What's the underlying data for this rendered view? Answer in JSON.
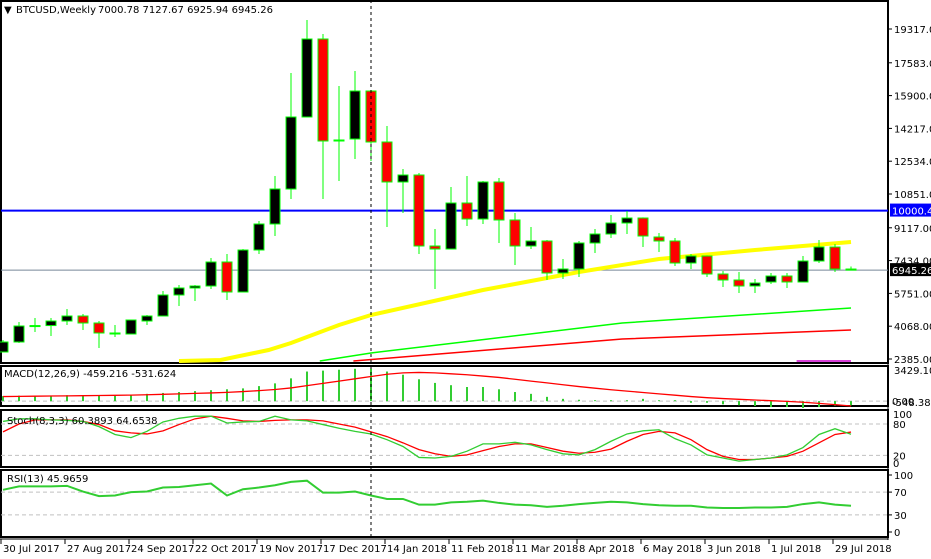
{
  "header": {
    "arrow": "▼",
    "symbol": "BTCUSD,Weekly",
    "ohlc": "7000.78 7127.67 6925.94 6945.26"
  },
  "colors": {
    "bull_body": "#000000",
    "bear_body": "#ff0000",
    "candle_outline": "#00ff00",
    "ma_fast": "#ffff00",
    "ma_mid": "#00ff00",
    "ma_slow": "#ff0000",
    "ma_extra": "#cc00cc",
    "level_line": "#0000ff",
    "price_line": "#778899",
    "indicator_main": "#32cd32",
    "indicator_signal": "#ff0000",
    "grid_dash": "#c0c0c0"
  },
  "price_axis": {
    "ticks": [
      "19317.00",
      "17583.00",
      "15900.00",
      "14217.00",
      "12534.00",
      "10851.00",
      "9117.00",
      "7434.00",
      "5751.00",
      "4068.00",
      "2385.00"
    ]
  },
  "horizontal_level": {
    "value": 10000.41,
    "label": "10000.41"
  },
  "current_price": {
    "value": 6945.26,
    "label": "6945.26"
  },
  "time_axis": {
    "labels": [
      {
        "i": 0,
        "text": "30 Jul 2017"
      },
      {
        "i": 4,
        "text": "27 Aug 2017"
      },
      {
        "i": 8,
        "text": "24 Sep 2017"
      },
      {
        "i": 12,
        "text": "22 Oct 2017"
      },
      {
        "i": 16,
        "text": "19 Nov 2017"
      },
      {
        "i": 20,
        "text": "17 Dec 2017"
      },
      {
        "i": 24,
        "text": "14 Jan 2018"
      },
      {
        "i": 28,
        "text": "11 Feb 2018"
      },
      {
        "i": 32,
        "text": "11 Mar 2018"
      },
      {
        "i": 36,
        "text": "8 Apr 2018"
      },
      {
        "i": 40,
        "text": "6 May 2018"
      },
      {
        "i": 44,
        "text": "3 Jun 2018"
      },
      {
        "i": 48,
        "text": "1 Jul 2018"
      },
      {
        "i": 52,
        "text": "29 Jul 2018"
      }
    ]
  },
  "crosshair_index": 23,
  "chart_data": {
    "type": "candlestick",
    "candles": [
      [
        2744,
        3360,
        2744,
        3257
      ],
      [
        3257,
        4283,
        3206,
        4078
      ],
      [
        4078,
        4488,
        3770,
        4100
      ],
      [
        4100,
        4488,
        3565,
        4334
      ],
      [
        4334,
        4950,
        4129,
        4591
      ],
      [
        4591,
        4694,
        3873,
        4232
      ],
      [
        4232,
        4334,
        2949,
        3719
      ],
      [
        3719,
        4129,
        3514,
        3667
      ],
      [
        3667,
        4400,
        3667,
        4386
      ],
      [
        4334,
        4642,
        4129,
        4591
      ],
      [
        4591,
        5874,
        4591,
        5669
      ],
      [
        5669,
        6182,
        5104,
        6028
      ],
      [
        6028,
        6182,
        5361,
        6130
      ],
      [
        6130,
        7567,
        5976,
        7362
      ],
      [
        7362,
        7772,
        5412,
        5822
      ],
      [
        5822,
        8029,
        5822,
        7977
      ],
      [
        7977,
        9465,
        7772,
        9312
      ],
      [
        9312,
        11774,
        8696,
        11107
      ],
      [
        11107,
        17059,
        10594,
        14802
      ],
      [
        14802,
        19779,
        14802,
        18804
      ],
      [
        18804,
        19060,
        10594,
        13570
      ],
      [
        13570,
        16392,
        11518,
        13622
      ],
      [
        13673,
        17162,
        12647,
        16136
      ],
      [
        16136,
        16187,
        12544,
        13519
      ],
      [
        13519,
        14340,
        9158,
        11467
      ],
      [
        11467,
        12134,
        9876,
        11826
      ],
      [
        11826,
        11928,
        7772,
        8183
      ],
      [
        8183,
        9055,
        5976,
        8029
      ],
      [
        8029,
        11210,
        8029,
        10389
      ],
      [
        10389,
        11774,
        9209,
        9568
      ],
      [
        9568,
        11518,
        9312,
        11467
      ],
      [
        11467,
        11672,
        8337,
        9517
      ],
      [
        9517,
        9876,
        7208,
        8183
      ],
      [
        8183,
        9158,
        8029,
        8439
      ],
      [
        8439,
        8491,
        6438,
        6797
      ],
      [
        6797,
        7516,
        6489,
        7003
      ],
      [
        7003,
        8439,
        6592,
        8337
      ],
      [
        8337,
        9055,
        7824,
        8798
      ],
      [
        8798,
        9773,
        8593,
        9363
      ],
      [
        9363,
        9979,
        8798,
        9619
      ],
      [
        9619,
        9650,
        8131,
        8696
      ],
      [
        8645,
        8850,
        7875,
        8439
      ],
      [
        8439,
        8593,
        7157,
        7310
      ],
      [
        7310,
        7772,
        7003,
        7670
      ],
      [
        7670,
        7700,
        6592,
        6746
      ],
      [
        6746,
        6900,
        6079,
        6438
      ],
      [
        6438,
        6849,
        5771,
        6130
      ],
      [
        6130,
        6489,
        5771,
        6284
      ],
      [
        6336,
        6797,
        6233,
        6643
      ],
      [
        6643,
        6797,
        6028,
        6336
      ],
      [
        6336,
        7670,
        6336,
        7413
      ],
      [
        7413,
        8491,
        7310,
        8131
      ],
      [
        8131,
        8285,
        6849,
        7000
      ],
      [
        7000.78,
        7127.67,
        6925.94,
        6945.26
      ]
    ],
    "moving_averages": [
      {
        "name": "ma_fast",
        "points": [
          [
            11,
            2231
          ],
          [
            13.6,
            2333
          ],
          [
            16.6,
            2846
          ],
          [
            18,
            3206
          ],
          [
            21,
            4129
          ],
          [
            23,
            4642
          ],
          [
            30,
            5925
          ],
          [
            36,
            6849
          ],
          [
            41,
            7516
          ],
          [
            47,
            7978
          ],
          [
            53,
            8388
          ]
        ]
      },
      {
        "name": "ma_mid",
        "points": [
          [
            19.8,
            2282
          ],
          [
            23,
            2693
          ],
          [
            29.8,
            3360
          ],
          [
            38.7,
            4232
          ],
          [
            53,
            5002
          ]
        ]
      },
      {
        "name": "ma_slow",
        "points": [
          [
            21.9,
            2282
          ],
          [
            38.7,
            3411
          ],
          [
            53,
            3873
          ]
        ]
      },
      {
        "name": "ma_extra",
        "points": [
          [
            49.6,
            2282
          ],
          [
            53,
            2282
          ]
        ]
      }
    ],
    "ylim": [
      2180,
      20805
    ],
    "macd": {
      "label": "MACD(12,26,9) -459.216 -531.624",
      "axis_labels": [
        "3429.107",
        "0.00",
        "-548.383"
      ],
      "histogram": [
        550,
        600,
        600,
        620,
        650,
        650,
        650,
        650,
        700,
        800,
        900,
        1000,
        1100,
        1200,
        1300,
        1400,
        1650,
        1950,
        2500,
        3250,
        3350,
        3450,
        3550,
        3550,
        3250,
        2900,
        2400,
        2000,
        1750,
        1550,
        1550,
        1300,
        1000,
        800,
        470,
        250,
        150,
        100,
        100,
        100,
        250,
        100,
        100,
        -180,
        -180,
        -350,
        -450,
        -530,
        -650,
        -650,
        -750,
        -650,
        -500,
        -459.216
      ],
      "signal": [
        500,
        520,
        540,
        560,
        580,
        600,
        620,
        640,
        660,
        700,
        750,
        800,
        850,
        900,
        960,
        1050,
        1150,
        1280,
        1450,
        1700,
        1950,
        2200,
        2450,
        2700,
        2950,
        3100,
        3150,
        3100,
        3000,
        2900,
        2750,
        2600,
        2400,
        2200,
        2000,
        1800,
        1600,
        1420,
        1250,
        1100,
        950,
        800,
        650,
        500,
        380,
        280,
        200,
        120,
        50,
        -30,
        -120,
        -250,
        -380,
        -531.624
      ],
      "ylim": [
        -535,
        3857
      ]
    },
    "stochastic": {
      "label": "Stoch(8,3,3) 60.3893 64.6538",
      "axis_labels": [
        "100",
        "80",
        "20",
        "0"
      ],
      "levels": [
        80,
        20
      ],
      "main": [
        85,
        90,
        90,
        88,
        87,
        85,
        75,
        60,
        54,
        66,
        84,
        91,
        95,
        95,
        82,
        84,
        85,
        95,
        88,
        86,
        79,
        72,
        66,
        61,
        50,
        37,
        16,
        15,
        18,
        28,
        42,
        42,
        45,
        40,
        31,
        23,
        21,
        31,
        47,
        61,
        67,
        69,
        52,
        40,
        21,
        15,
        9,
        12,
        15,
        21,
        35,
        60,
        71,
        60.3893
      ],
      "signal": [
        65,
        80,
        88,
        88,
        88,
        85,
        79,
        67,
        63,
        61,
        67,
        79,
        90,
        95,
        91,
        86,
        85,
        87,
        88,
        88,
        86,
        80,
        74,
        65,
        56,
        44,
        31,
        23,
        18,
        21,
        29,
        37,
        42,
        42,
        35,
        28,
        24,
        26,
        32,
        47,
        60,
        66,
        63,
        50,
        31,
        18,
        12,
        12,
        15,
        18,
        28,
        44,
        60,
        64.6538
      ],
      "ylim": [
        -2.3,
        106.9
      ]
    },
    "rsi": {
      "label": "RSI(13) 45.9659",
      "axis_labels": [
        "100",
        "70",
        "30",
        "0"
      ],
      "levels": [
        70,
        30
      ],
      "values": [
        74,
        80,
        80,
        80,
        81,
        71,
        63,
        64,
        70,
        71,
        78,
        79,
        82,
        85,
        64,
        75,
        78,
        82,
        88,
        90,
        69,
        69,
        71,
        64,
        58,
        58,
        48,
        48,
        52,
        53,
        55,
        51,
        48,
        47,
        44,
        46,
        49,
        51,
        53,
        52,
        49,
        47,
        46,
        46,
        43,
        42,
        42,
        43,
        43,
        44,
        49,
        52,
        48,
        45.9659
      ],
      "ylim": [
        0,
        100
      ]
    }
  }
}
